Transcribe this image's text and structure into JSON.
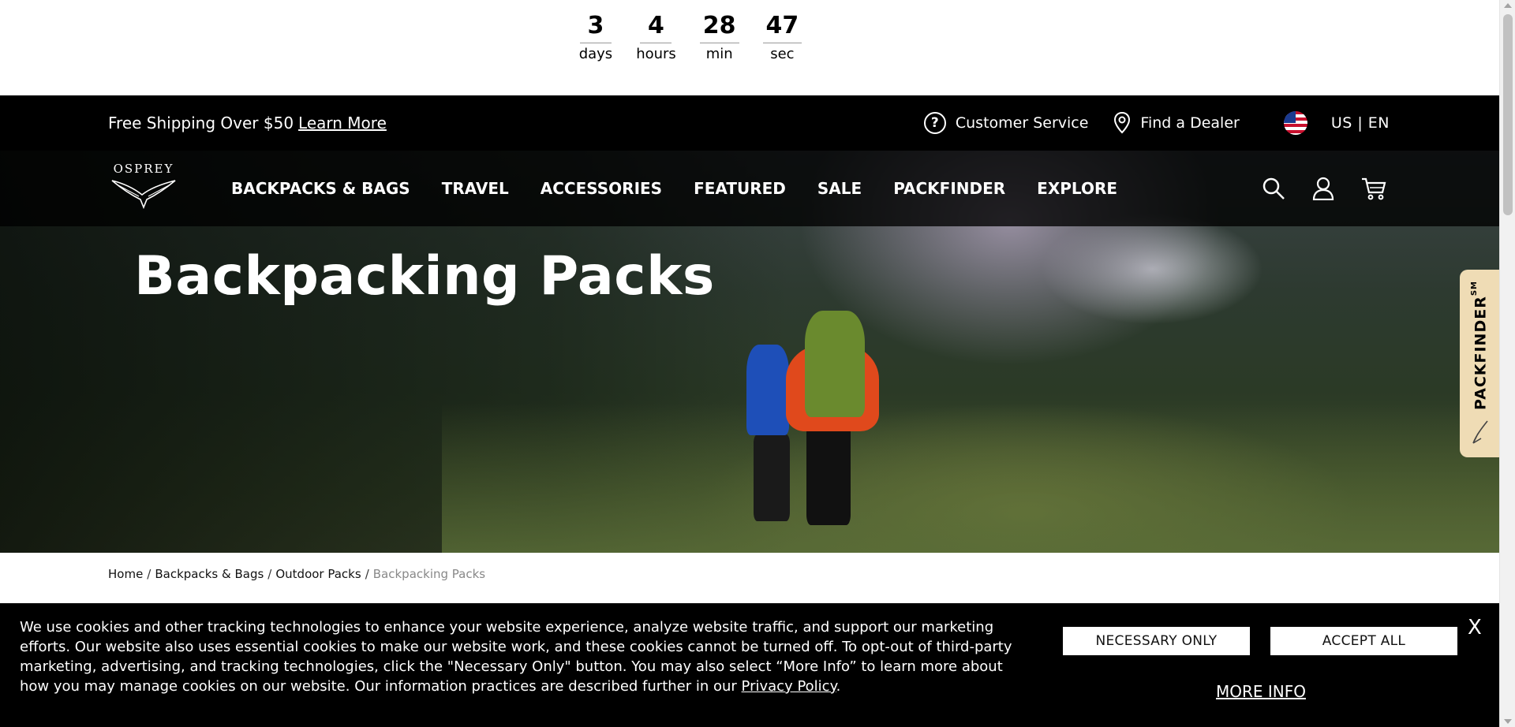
{
  "countdown": {
    "days": "3",
    "days_label": "days",
    "hours": "4",
    "hours_label": "hours",
    "min": "28",
    "min_label": "min",
    "sec": "47",
    "sec_label": "sec"
  },
  "utility": {
    "shipping_text": "Free Shipping Over $50",
    "learn_more": "Learn More",
    "customer_service": "Customer Service",
    "find_dealer": "Find a Dealer",
    "locale": "US | EN"
  },
  "nav": {
    "logo_text": "OSPREY",
    "items": [
      "BACKPACKS & BAGS",
      "TRAVEL",
      "ACCESSORIES",
      "FEATURED",
      "SALE",
      "PACKFINDER",
      "EXPLORE"
    ],
    "icons": [
      "search-icon",
      "account-icon",
      "cart-icon"
    ]
  },
  "hero": {
    "title": "Backpacking Packs"
  },
  "packfinder_tab": {
    "label": "PACKFINDER",
    "mark": "SM"
  },
  "breadcrumb": {
    "items": [
      "Home",
      "Backpacks & Bags",
      "Outdoor Packs"
    ],
    "current": "Backpacking Packs"
  },
  "cookie": {
    "text": "We use cookies and other tracking technologies to enhance your website experience, analyze website traffic, and support our marketing efforts. Our website also uses essential cookies to make our website work, and these cookies cannot be turned off. To opt-out of third-party marketing, advertising, and tracking technologies, click the \"Necessary Only\" button. You may also select “More Info” to learn more about how you may manage cookies on our website. Our information practices are described further in our",
    "privacy_link": "Privacy Policy",
    "period": ".",
    "necessary_only": "NECESSARY ONLY",
    "accept_all": "ACCEPT ALL",
    "more_info": "MORE INFO",
    "close": "X"
  }
}
